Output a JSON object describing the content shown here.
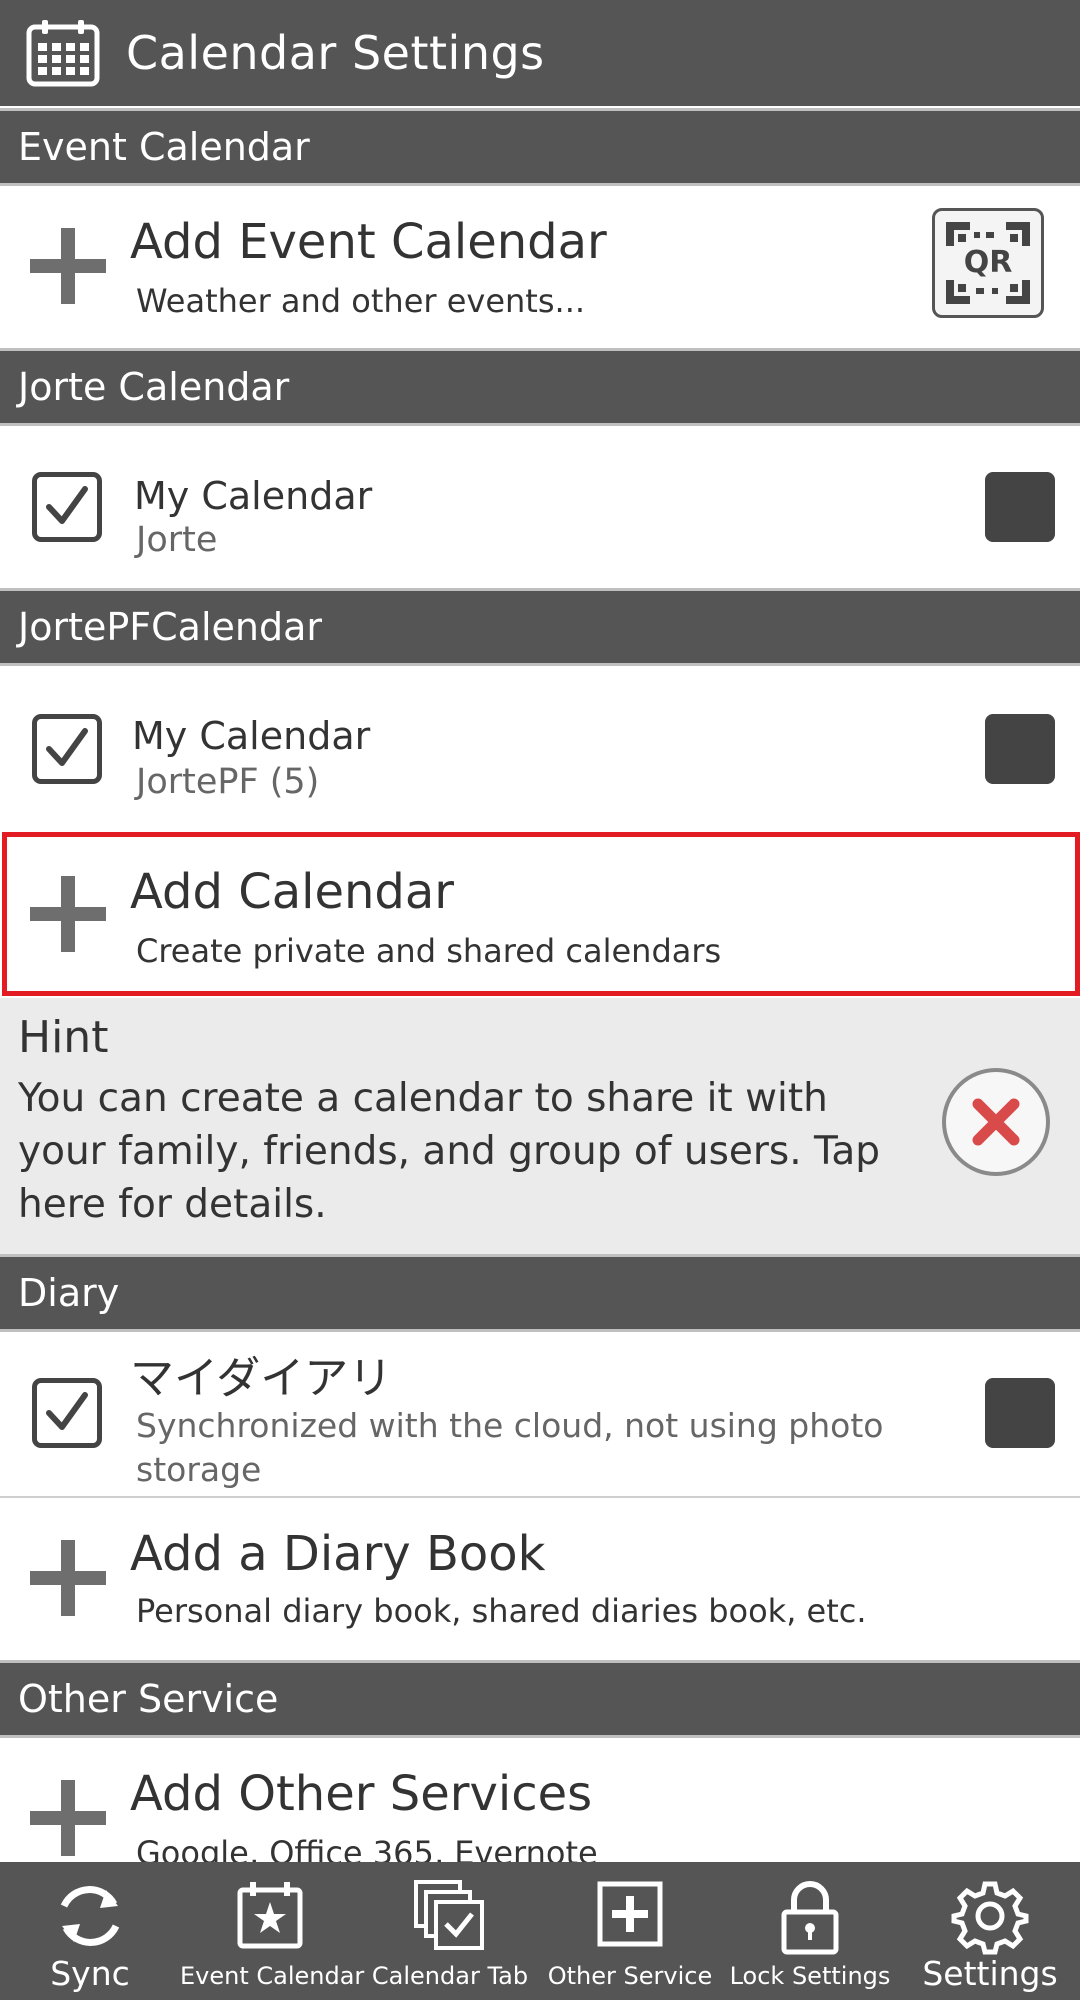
{
  "header": {
    "title": "Calendar Settings",
    "icon": "calendar-icon"
  },
  "sections": {
    "event_calendar": "Event Calendar",
    "jorte_calendar": "Jorte Calendar",
    "jortepf_calendar": "JortePFCalendar",
    "diary": "Diary",
    "other_service": "Other Service"
  },
  "add_event_calendar": {
    "title": "Add Event Calendar",
    "subtitle": "Weather and other events...",
    "qr_label": "QR"
  },
  "jorte_item": {
    "title": "My Calendar",
    "subtitle": "Jorte",
    "checked": true,
    "color": "#444444"
  },
  "jortepf_item": {
    "title": "My Calendar",
    "subtitle": "JortePF (5)",
    "checked": true,
    "color": "#444444"
  },
  "add_calendar": {
    "title": "Add Calendar",
    "subtitle": "Create private and shared calendars"
  },
  "hint": {
    "title": "Hint",
    "body": "You can create a calendar to share it with your family, friends, and group of users. Tap here for details."
  },
  "diary_item": {
    "title": "マイダイアリ",
    "subtitle": "Synchronized with the cloud, not using photo storage",
    "checked": true,
    "color": "#444444"
  },
  "add_diary": {
    "title": "Add a Diary Book",
    "subtitle": "Personal diary book, shared diaries book, etc."
  },
  "add_other": {
    "title": "Add Other Services",
    "subtitle": "Google, Office 365, Evernote"
  },
  "nav": [
    {
      "label": "Sync",
      "icon": "sync-icon"
    },
    {
      "label": "Event Calendar",
      "icon": "event-calendar-icon"
    },
    {
      "label": "Calendar Tab",
      "icon": "calendar-tab-icon"
    },
    {
      "label": "Other Service",
      "icon": "other-service-icon"
    },
    {
      "label": "Lock Settings",
      "icon": "lock-icon"
    },
    {
      "label": "Settings",
      "icon": "gear-icon"
    }
  ],
  "colors": {
    "bar": "#555555",
    "highlight": "#e31b23",
    "close": "#d94a4a"
  }
}
